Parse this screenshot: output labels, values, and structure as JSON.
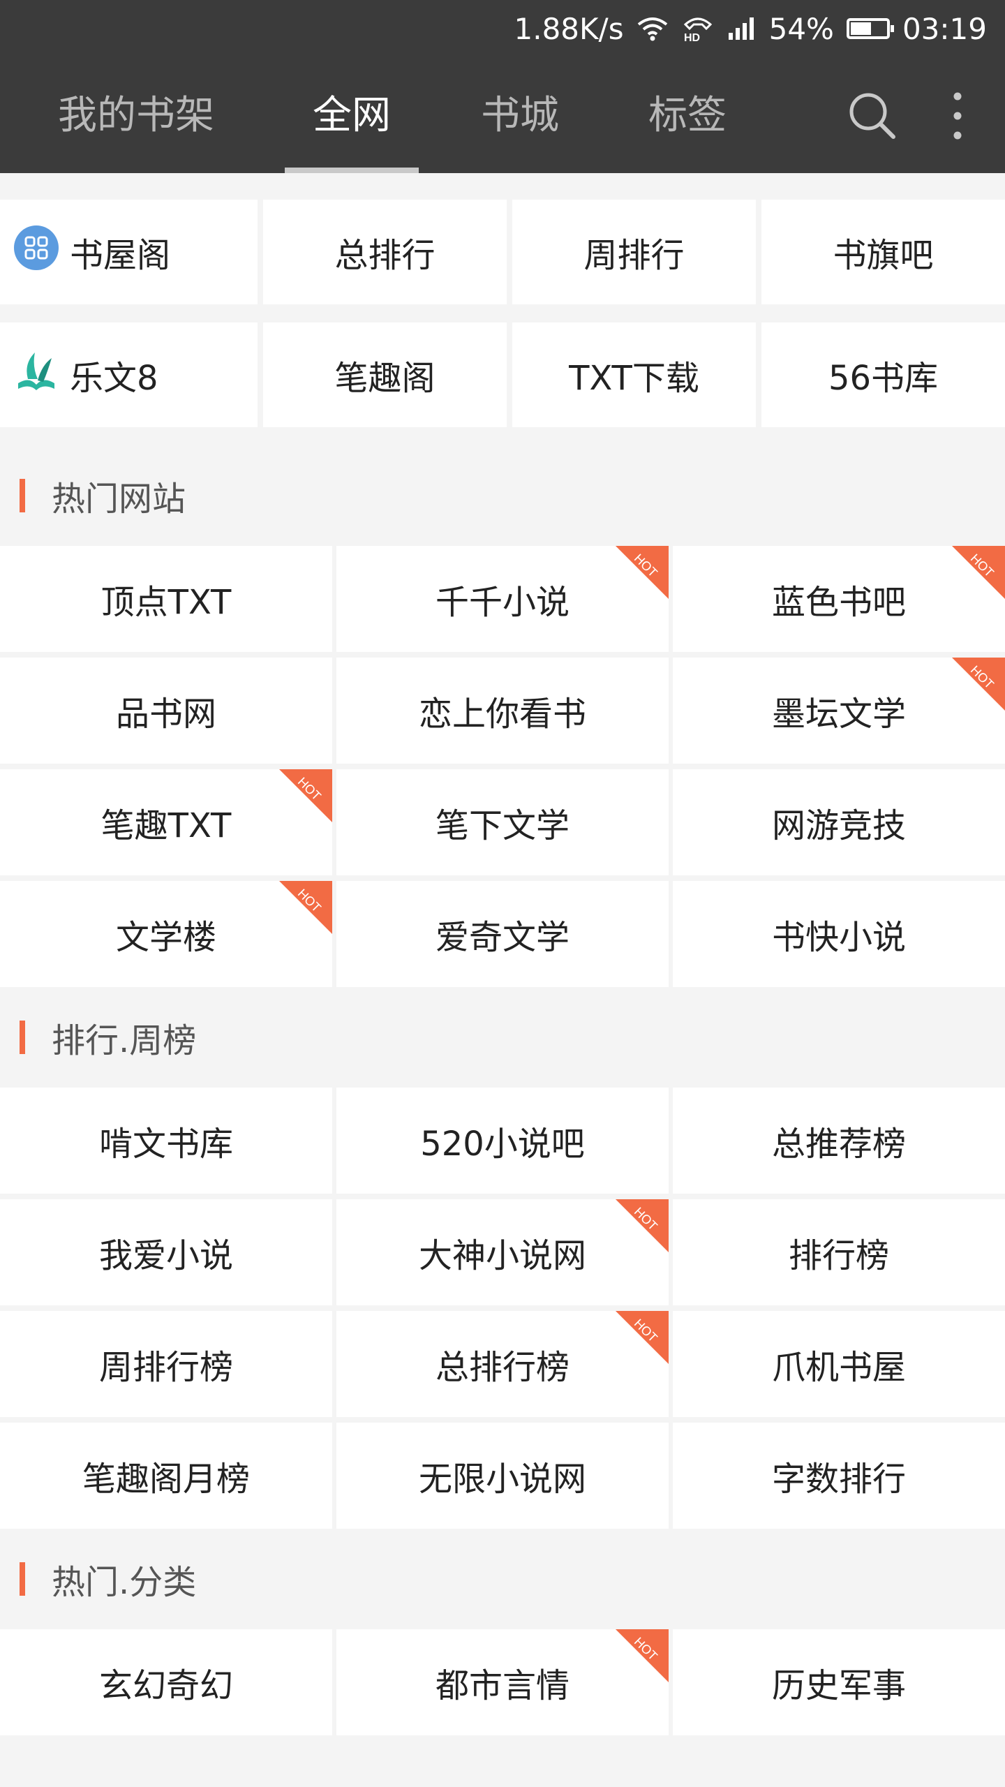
{
  "status_bar": {
    "net_speed": "1.88K/s",
    "battery_text": "54%",
    "battery_level": 0.54,
    "time": "03:19",
    "icons": [
      "wifi-icon",
      "hd-call-icon",
      "signal-icon",
      "battery-icon"
    ]
  },
  "tabs": [
    {
      "label": "我的书架"
    },
    {
      "label": "全网",
      "active": true
    },
    {
      "label": "书城"
    },
    {
      "label": "标签"
    }
  ],
  "quick_links": [
    [
      {
        "label": "书屋阁",
        "icon": "grid-app-icon"
      },
      {
        "label": "总排行"
      },
      {
        "label": "周排行"
      },
      {
        "label": "书旗吧"
      }
    ],
    [
      {
        "label": "乐文8",
        "icon": "book-leaf-icon"
      },
      {
        "label": "笔趣阁"
      },
      {
        "label": "TXT下载"
      },
      {
        "label": "56书库"
      }
    ]
  ],
  "hot_badge_text": "HOT",
  "sections": [
    {
      "title": "热门网站",
      "items": [
        {
          "label": "顶点TXT",
          "hot": false
        },
        {
          "label": "千千小说",
          "hot": true
        },
        {
          "label": "蓝色书吧",
          "hot": true
        },
        {
          "label": "品书网",
          "hot": false
        },
        {
          "label": "恋上你看书",
          "hot": false
        },
        {
          "label": "墨坛文学",
          "hot": true
        },
        {
          "label": "笔趣TXT",
          "hot": true
        },
        {
          "label": "笔下文学",
          "hot": false
        },
        {
          "label": "网游竞技",
          "hot": false
        },
        {
          "label": "文学楼",
          "hot": true
        },
        {
          "label": "爱奇文学",
          "hot": false
        },
        {
          "label": "书快小说",
          "hot": false
        }
      ]
    },
    {
      "title": "排行.周榜",
      "items": [
        {
          "label": "啃文书库",
          "hot": false
        },
        {
          "label": "520小说吧",
          "hot": false
        },
        {
          "label": "总推荐榜",
          "hot": false
        },
        {
          "label": "我爱小说",
          "hot": false
        },
        {
          "label": "大神小说网",
          "hot": true
        },
        {
          "label": "排行榜",
          "hot": false
        },
        {
          "label": "周排行榜",
          "hot": false
        },
        {
          "label": "总排行榜",
          "hot": true
        },
        {
          "label": "爪机书屋",
          "hot": false
        },
        {
          "label": "笔趣阁月榜",
          "hot": false
        },
        {
          "label": "无限小说网",
          "hot": false
        },
        {
          "label": "字数排行",
          "hot": false
        }
      ]
    },
    {
      "title": "热门.分类",
      "items": [
        {
          "label": "玄幻奇幻",
          "hot": false
        },
        {
          "label": "都市言情",
          "hot": true
        },
        {
          "label": "历史军事",
          "hot": false
        }
      ]
    }
  ],
  "colors": {
    "header_bg": "#3b3b3b",
    "accent": "#f26b44",
    "page_bg": "#f4f4f4"
  }
}
